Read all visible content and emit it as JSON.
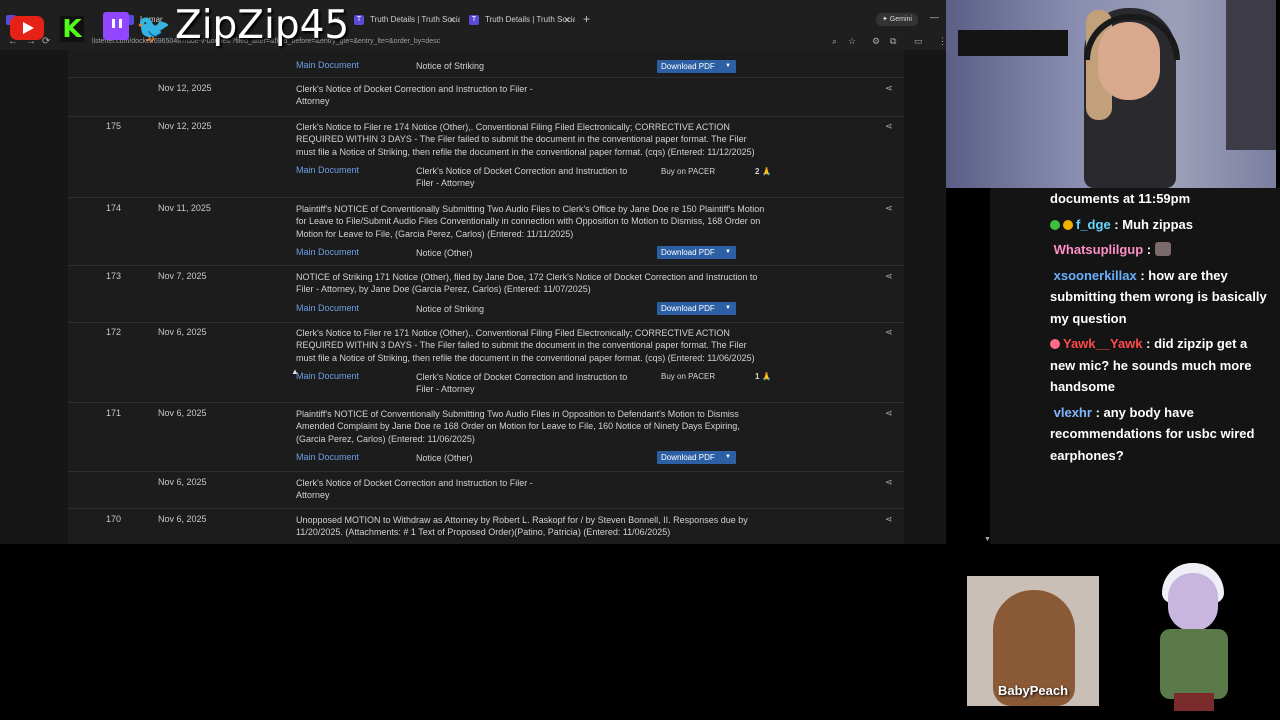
{
  "browser": {
    "tabs": [
      {
        "title": "me"
      },
      {
        "title": "Lamar"
      },
      {
        "title": ""
      },
      {
        "title": "Truth Details | Truth Social"
      },
      {
        "title": "Truth Details | Truth Social"
      }
    ],
    "new_tab": "+",
    "gemini": "✦ Gemini",
    "url": "listener.com/docket/69650487/doe-v-bonnell/?filed_after=&filed_before=&entry_gte=&entry_lte=&order_by=desc"
  },
  "overlay": {
    "handle": "ZipZip45"
  },
  "docket": {
    "top_attachment": {
      "link": "Main Document",
      "desc": "Notice of Striking",
      "action": "Download PDF"
    },
    "entries": [
      {
        "num": "",
        "date": "Nov 12, 2025",
        "desc": "Clerk's Notice of Docket Correction and Instruction to Filer - Attorney"
      },
      {
        "num": "175",
        "date": "Nov 12, 2025",
        "desc": "Clerk's Notice to Filer re 174 Notice (Other),. Conventional Filing Filed Electronically; CORRECTIVE ACTION REQUIRED WITHIN 3 DAYS - The Filer failed to submit the document in the conventional paper format. The Filer must file a Notice of Striking, then refile the document in the conventional paper format. (cqs) (Entered: 11/12/2025)",
        "att_link": "Main Document",
        "att_desc": "Clerk's Notice of Docket Correction and Instruction to Filer - Attorney",
        "action": "Buy on PACER",
        "count": "2"
      },
      {
        "num": "174",
        "date": "Nov 11, 2025",
        "desc": "Plaintiff's NOTICE of Conventionally Submitting Two Audio Files to Clerk's Office by Jane Doe re 150 Plaintiff's Motion for Leave to File/Submit Audio Files Conventionally in connection with Opposition to Motion to Dismiss, 168 Order on Motion for Leave to File, (Garcia Perez, Carlos) (Entered: 11/11/2025)",
        "att_link": "Main Document",
        "att_desc": "Notice (Other)",
        "action": "Download PDF"
      },
      {
        "num": "173",
        "date": "Nov 7, 2025",
        "desc": "NOTICE of Striking 171 Notice (Other), filed by Jane Doe, 172 Clerk's Notice of Docket Correction and Instruction to Filer - Attorney, by Jane Doe (Garcia Perez, Carlos) (Entered: 11/07/2025)",
        "att_link": "Main Document",
        "att_desc": "Notice of Striking",
        "action": "Download PDF"
      },
      {
        "num": "172",
        "date": "Nov 6, 2025",
        "desc": "Clerk's Notice to Filer re 171 Notice (Other),. Conventional Filing Filed Electronically; CORRECTIVE ACTION REQUIRED WITHIN 3 DAYS - The Filer failed to submit the document in the conventional paper format. The Filer must file a Notice of Striking, then refile the document in the conventional paper format. (cqs) (Entered: 11/06/2025)",
        "att_link": "Main Document",
        "att_desc": "Clerk's Notice of Docket Correction and Instruction to Filer - Attorney",
        "action": "Buy on PACER",
        "count": "1"
      },
      {
        "num": "171",
        "date": "Nov 6, 2025",
        "desc": "Plaintiff's NOTICE of Conventionally Submitting Two Audio Files in Opposition to Defendant's Motion to Dismiss Amended Complaint by Jane Doe re 168 Order on Motion for Leave to File, 160 Notice of Ninety Days Expiring, (Garcia Perez, Carlos) (Entered: 11/06/2025)",
        "att_link": "Main Document",
        "att_desc": "Notice (Other)",
        "action": "Download PDF"
      },
      {
        "num": "",
        "date": "Nov 6, 2025",
        "desc": "Clerk's Notice of Docket Correction and Instruction to Filer - Attorney"
      },
      {
        "num": "170",
        "date": "Nov 6, 2025",
        "desc": "Unopposed MOTION to Withdraw as Attorney by Robert L. Raskopf for / by Steven Bonnell, II. Responses due by 11/20/2025. (Attachments: # 1 Text of Proposed Order)(Patino, Patricia) (Entered: 11/06/2025)"
      }
    ]
  },
  "chat": {
    "messages": [
      {
        "user": "",
        "text": "documents at 11:59pm",
        "color": "#ffffff"
      },
      {
        "user": "f_dge",
        "text": ": Muh zippas",
        "color": "#6ad6ff"
      },
      {
        "user": "Whatsuplilgup",
        "text": ":",
        "color": "#ff8fc7"
      },
      {
        "user": "xsoonerkillax",
        "text": ": how are they submitting them wrong is basically my question",
        "color": "#6ab0ff"
      },
      {
        "user": "Yawk__Yawk",
        "text": ": did zipzip get a new mic? he sounds much more handsome",
        "color": "#ff4a4a"
      },
      {
        "user": "vlexhr",
        "text": ": any body have recommendations for usbc wired earphones?",
        "color": "#7fb8ff"
      }
    ]
  },
  "cams": {
    "guest_name": "BabyPeach"
  },
  "icons": {
    "share": "share-icon",
    "youtube": "youtube-icon",
    "kick": "kick-icon",
    "twitch": "twitch-icon",
    "twitter": "twitter-icon"
  }
}
